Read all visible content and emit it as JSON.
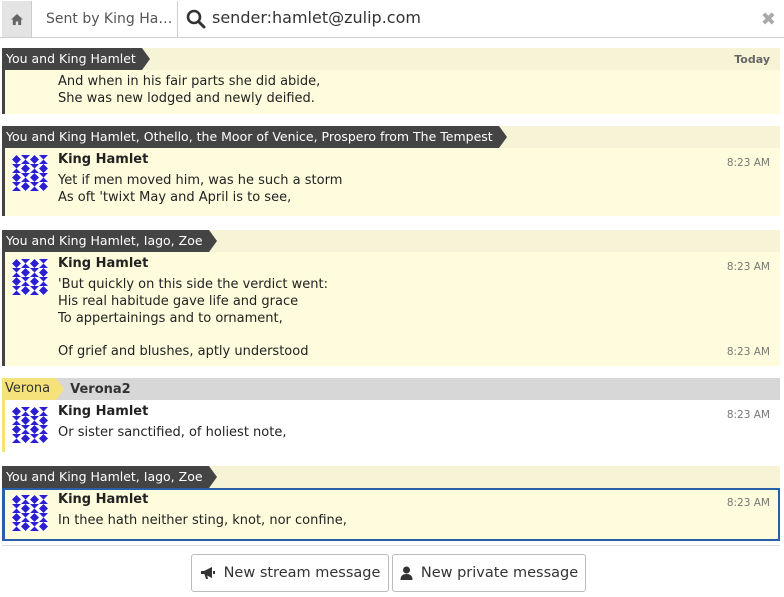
{
  "search": {
    "crumb": "Sent by King Ha…",
    "query": "sender:hamlet@zulip.com"
  },
  "groups": [
    {
      "recipient": "You and King Hamlet",
      "date": "Today",
      "lines": [
        "And when in his fair parts she did abide,",
        "She was new lodged and newly deified."
      ]
    },
    {
      "recipient": "You and King Hamlet, Othello, the Moor of Venice, Prospero from The Tempest",
      "sender": "King Hamlet",
      "time": "8:23 AM",
      "lines": [
        "Yet if men moved him, was he such a storm",
        "As oft 'twixt May and April is to see,"
      ]
    },
    {
      "recipient": "You and King Hamlet, Iago, Zoe",
      "sender": "King Hamlet",
      "time": "8:23 AM",
      "lines": [
        "'But quickly on this side the verdict went:",
        "His real habitude gave life and grace",
        "To appertainings and to ornament,"
      ],
      "followup": {
        "text": "Of grief and blushes, aptly understood",
        "time": "8:23 AM"
      }
    },
    {
      "stream": "Verona",
      "topic": "Verona2",
      "sender": "King Hamlet",
      "time": "8:23 AM",
      "lines": [
        "Or sister sanctified, of holiest note,"
      ]
    },
    {
      "recipient": "You and King Hamlet, Iago, Zoe",
      "sender": "King Hamlet",
      "time": "8:23 AM",
      "lines": [
        "In thee hath neither sting, knot, nor confine,"
      ]
    }
  ],
  "compose": {
    "stream_btn": "New stream message",
    "private_btn": "New private message"
  },
  "colors": {
    "pm_bg": "#fefcdc",
    "stream_color": "#f5e27a",
    "selected_border": "#2a5ea8"
  }
}
